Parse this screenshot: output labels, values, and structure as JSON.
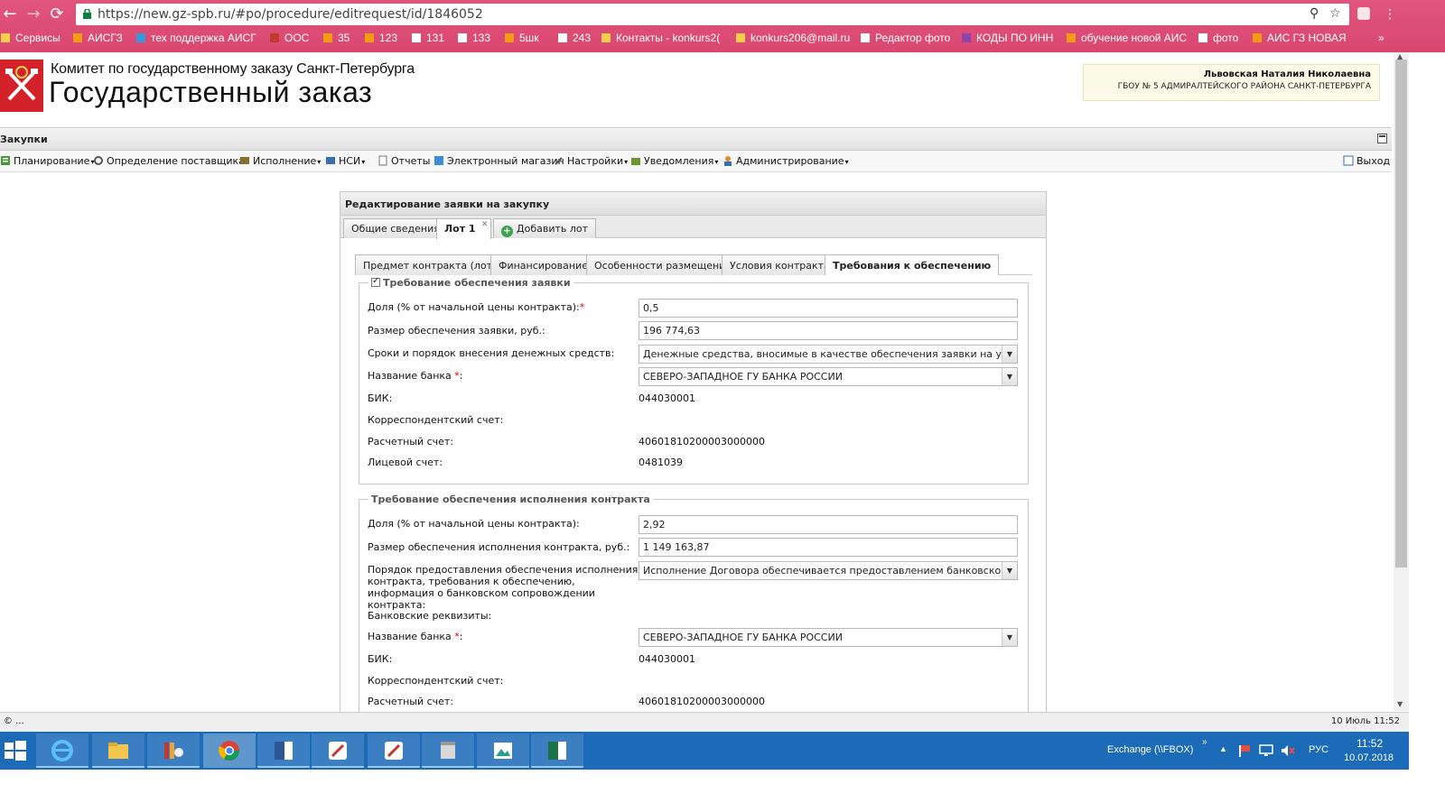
{
  "browser": {
    "url": "https://new.gz-spb.ru/#po/procedure/editrequest/id/1846052",
    "bookmarks": [
      {
        "label": "Сервисы",
        "icon": "apps-icon"
      },
      {
        "label": "АИСГЗ",
        "icon": "spb-icon"
      },
      {
        "label": "тех поддержка АИСГ",
        "icon": "globe-icon"
      },
      {
        "label": "ООС",
        "icon": "emblem-icon"
      },
      {
        "label": "35",
        "icon": "spb-icon"
      },
      {
        "label": "123",
        "icon": "spb-icon"
      },
      {
        "label": "131",
        "icon": "page-icon"
      },
      {
        "label": "133",
        "icon": "page-icon"
      },
      {
        "label": "5шк",
        "icon": "spb-icon"
      },
      {
        "label": "243",
        "icon": "page-icon"
      },
      {
        "label": "Контакты - konkurs2(",
        "icon": "at-icon"
      },
      {
        "label": "konkurs206@mail.ru",
        "icon": "at-icon"
      },
      {
        "label": "Редактор фото",
        "icon": "photo-icon"
      },
      {
        "label": "КОДЫ ПО ИНН",
        "icon": "inn-icon"
      },
      {
        "label": "обучение новой АИС",
        "icon": "spb-icon"
      },
      {
        "label": "фото",
        "icon": "pen-icon"
      },
      {
        "label": "АИС ГЗ НОВАЯ",
        "icon": "spb-icon"
      }
    ],
    "more": "»"
  },
  "header": {
    "org_title": "Комитет по государственному заказу Санкт-Петербурга",
    "site_title": "Государственный заказ",
    "user_name": "Львовская Наталия Николаевна",
    "user_org": "ГБОУ № 5 АДМИРАЛТЕЙСКОГО РАЙОНА САНКТ-ПЕТЕРБУРГА"
  },
  "section": {
    "title": "Закупки"
  },
  "menu": {
    "items": [
      "Планирование",
      "Определение поставщика",
      "Исполнение",
      "НСИ",
      "Отчеты",
      "Электронный магазин",
      "Настройки",
      "Уведомления",
      "Администрирование"
    ],
    "exit": "Выход"
  },
  "panel": {
    "title": "Редактирование заявки на закупку",
    "tabs": [
      "Общие сведения",
      "Лот 1",
      "Добавить лот"
    ],
    "inner_tabs": [
      "Предмет контракта (лота)",
      "Финансирование",
      "Особенности размещения",
      "Условия контракта",
      "Требования к обеспечению"
    ]
  },
  "bid_security": {
    "legend": "Требование обеспечения заявки",
    "share_label": "Доля (% от начальной цены контракта):",
    "share_value": "0,5",
    "amount_label": "Размер обеспечения заявки, руб.:",
    "amount_value": "196 774,63",
    "terms_label": "Сроки и порядок внесения денежных средств:",
    "terms_value": "Денежные средства, вносимые в качестве обеспечения заявки на участие",
    "bank_label": "Название банка",
    "bank_value": "СЕВЕРО-ЗАПАДНОЕ ГУ БАНКА РОССИИ",
    "bik_label": "БИК:",
    "bik_value": "044030001",
    "corr_label": "Корреспондентский счет:",
    "account_label": "Расчетный счет:",
    "account_value": "40601810200003000000",
    "personal_label": "Лицевой счет:",
    "personal_value": "0481039"
  },
  "contract_security": {
    "legend": "Требование обеспечения исполнения контракта",
    "share_label": "Доля (% от начальной цены контракта):",
    "share_value": "2,92",
    "amount_label": "Размер обеспечения исполнения контракта, руб.:",
    "amount_value": "1 149 163,87",
    "order_label": "Порядок предоставления обеспечения исполнения контракта, требования к обеспечению, информация о банковском сопровождении контракта:",
    "order_value": "Исполнение Договора обеспечивается предоставлением банковской гарантии",
    "bank_details_label": "Банковские реквизиты:",
    "bank_label": "Название банка",
    "bank_value": "СЕВЕРО-ЗАПАДНОЕ ГУ БАНКА РОССИИ",
    "bik_label": "БИК:",
    "bik_value": "044030001",
    "corr_label": "Корреспондентский счет:",
    "account_label": "Расчетный счет:",
    "account_value": "40601810200003000000"
  },
  "status_bar": {
    "left": "© ...",
    "right": "10 Июль 11:52"
  },
  "taskbar": {
    "tray_label": "Exchange (\\\\FBOX)",
    "lang": "РУС",
    "time": "11:52",
    "date": "10.07.2018"
  },
  "colors": {
    "chrome": "#d9476f",
    "taskbar": "#1b6bb8",
    "logo": "#d4222a",
    "required": "#dd0000"
  }
}
